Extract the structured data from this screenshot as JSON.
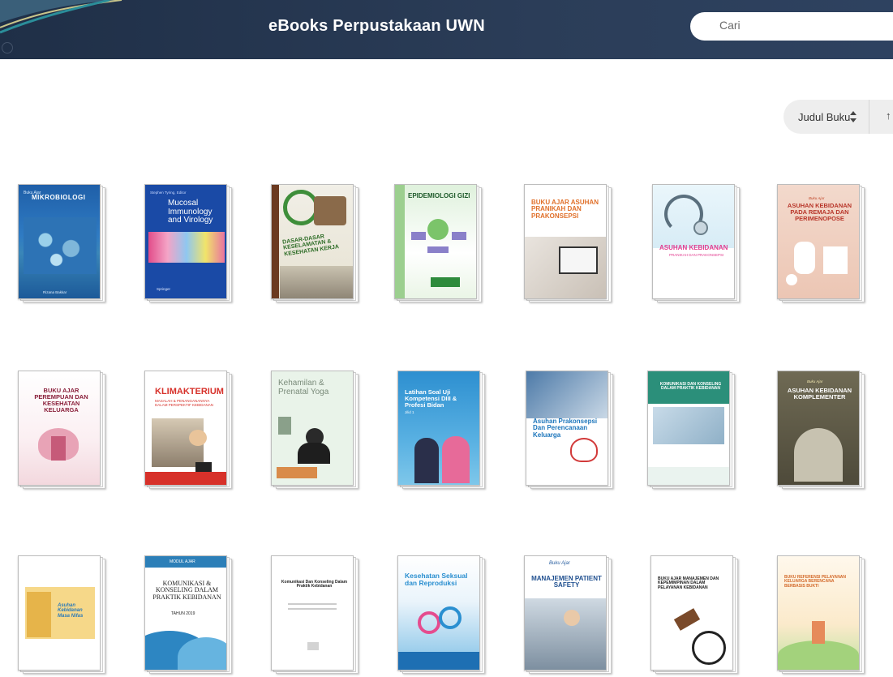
{
  "header": {
    "title": "eBooks Perpustakaan UWN",
    "search_placeholder": "Cari"
  },
  "sort": {
    "label": "Judul Buku"
  },
  "books": [
    {
      "title": "MIKROBIOLOGI",
      "subtitle": "Buku Ajar",
      "footer": "Rizana Bakkar"
    },
    {
      "title": "Mucosal Immunology and Virology",
      "subtitle": "Stephen Tyring, Editor",
      "footer": "Springer"
    },
    {
      "title": "DASAR-DASAR KESELAMATAN & KESEHATAN KERJA",
      "subtitle": "",
      "footer": ""
    },
    {
      "title": "EPIDEMIOLOGI GIZI",
      "subtitle": "",
      "footer": ""
    },
    {
      "title": "BUKU AJAR ASUHAN PRANIKAH DAN PRAKONSEPSI",
      "subtitle": "",
      "footer": ""
    },
    {
      "title": "ASUHAN KEBIDANAN",
      "subtitle": "PRANIKAH DAN PRAKONSEPSI",
      "footer": ""
    },
    {
      "title": "ASUHAN KEBIDANAN PADA REMAJA DAN PERIMENOPOSE",
      "subtitle": "Buku Ajar",
      "footer": ""
    },
    {
      "title": "BUKU AJAR PEREMPUAN DAN KESEHATAN KELUARGA",
      "subtitle": "",
      "footer": ""
    },
    {
      "title": "KLIMAKTERIUM",
      "subtitle": "MASALAH & PENANGANANNYA DALAM PERSPEKTIF KEBIDANAN",
      "footer": ""
    },
    {
      "title": "Kehamilan & Prenatal Yoga",
      "subtitle": "",
      "footer": ""
    },
    {
      "title": "Latihan Soal Uji Kompetensi DIII & Profesi Bidan",
      "subtitle": "Jilid 1",
      "footer": ""
    },
    {
      "title": "Asuhan Prakonsepsi Dan Perencanaan Keluarga",
      "subtitle": "",
      "footer": ""
    },
    {
      "title": "KOMUNIKASI DAN KONSELING DALAM PRAKTIK KEBIDANAN",
      "subtitle": "",
      "footer": ""
    },
    {
      "title": "ASUHAN KEBIDANAN KOMPLEMENTER",
      "subtitle": "Buku Ajar",
      "footer": ""
    },
    {
      "title": "Asuhan Kebidanan Masa Nifas",
      "subtitle": "",
      "footer": ""
    },
    {
      "title": "KOMUNIKASI & KONSELING DALAM PRAKTIK KEBIDANAN",
      "subtitle": "MODUL AJAR",
      "footer": "TAHUN 2019"
    },
    {
      "title": "Komunikasi Dan Konseling Dalam Praktik Kebidanan",
      "subtitle": "",
      "footer": ""
    },
    {
      "title": "Kesehatan Seksual dan Reproduksi",
      "subtitle": "",
      "footer": ""
    },
    {
      "title": "MANAJEMEN PATIENT SAFETY",
      "subtitle": "Buku Ajar",
      "footer": ""
    },
    {
      "title": "BUKU AJAR MANAJEMEN DAN KEPEMIMPINAN DALAM PELAYANAN KEBIDANAN",
      "subtitle": "",
      "footer": ""
    },
    {
      "title": "BUKU REFERENSI PELAYANAN KELUARGA BERENCANA BERBASIS BUKTI",
      "subtitle": "",
      "footer": ""
    }
  ]
}
